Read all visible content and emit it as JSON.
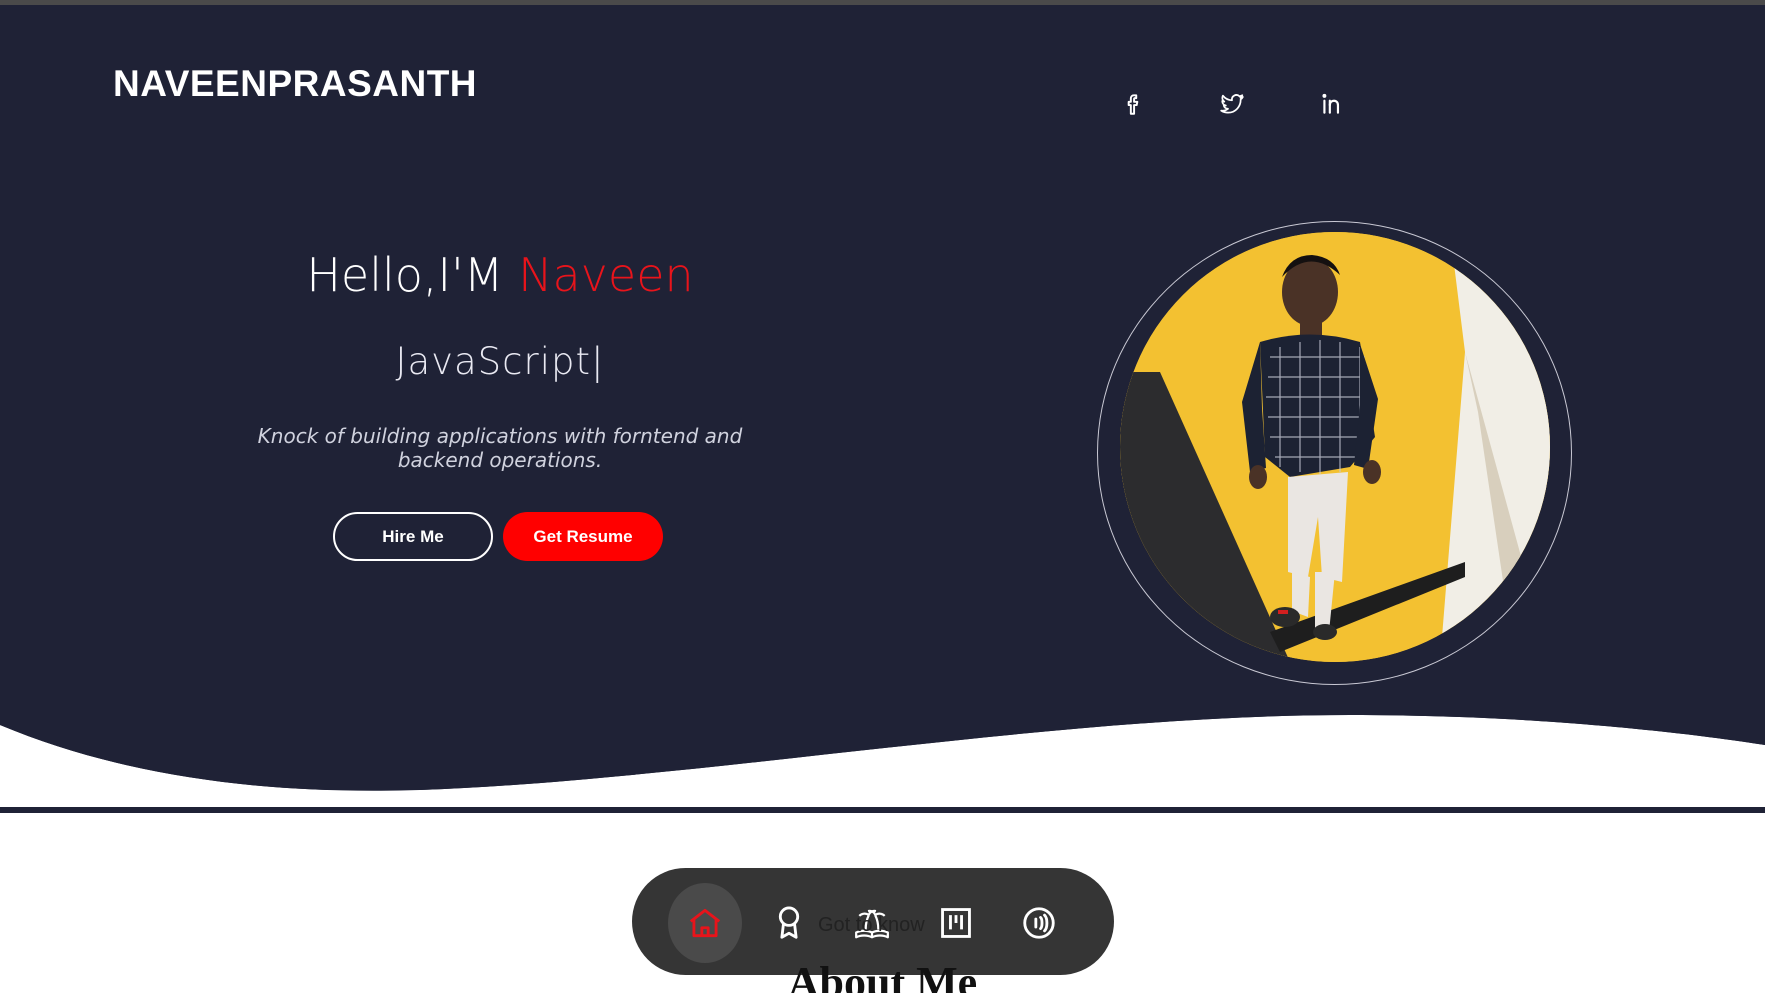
{
  "brand": {
    "name": "NAVEENPRASANTH"
  },
  "social": [
    {
      "icon": "facebook-icon"
    },
    {
      "icon": "twitter-icon"
    },
    {
      "icon": "linkedin-icon"
    }
  ],
  "hero": {
    "greeting": "Hello,I'M",
    "name": "Naveen",
    "typed_text": "JavaScript|",
    "description": "Knock of building applications with forntend and backend operations.",
    "hire_label": "Hire Me",
    "resume_label": "Get Resume"
  },
  "colors": {
    "background": "#1f2236",
    "accent": "#ff0000",
    "name_color": "#e8141b",
    "dock": "#353535"
  },
  "dock": {
    "items": [
      {
        "icon": "home-icon",
        "active": true
      },
      {
        "icon": "award-icon",
        "active": false
      },
      {
        "icon": "island-book-icon",
        "active": false
      },
      {
        "icon": "projects-board-icon",
        "active": false
      },
      {
        "icon": "contact-signal-icon",
        "active": false
      }
    ],
    "tooltip": "Got to know"
  },
  "section": {
    "title": "About Me"
  }
}
